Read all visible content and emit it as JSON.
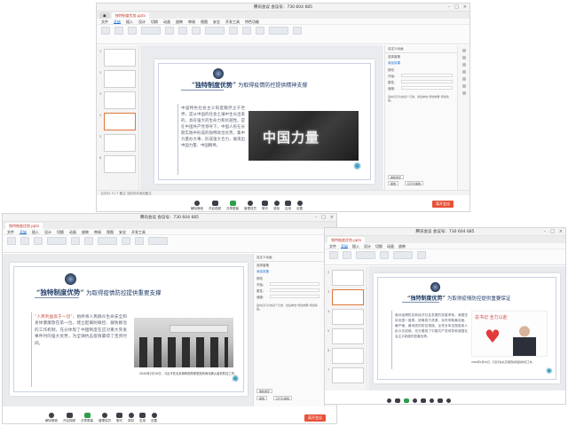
{
  "meeting": {
    "title": "腾讯会议 会议号：730 604 685",
    "end_label": "离开会议",
    "toolbar": [
      "解除静音",
      "开启视频",
      "共享屏幕",
      "管理成员",
      "聊天",
      "录制",
      "应用",
      "设置"
    ]
  },
  "editor": {
    "tab": "独特制度优势.pptx",
    "menus": [
      "文件",
      "开始",
      "插入",
      "设计",
      "切换",
      "动画",
      "放映",
      "审阅",
      "视图",
      "安全",
      "开发工具",
      "特色功能"
    ],
    "active_menu": "开始",
    "sidepanel": {
      "header": "自定义动画",
      "subheader": "选择窗格",
      "add_effect": "添加效果",
      "labels": [
        "修改",
        "开始：",
        "属性：",
        "速度："
      ],
      "hint": "选中幻灯片的某个元素，然后单击\"添加效果\"添加动画。",
      "buttons": [
        "重新排序",
        "播放",
        "幻灯片播放"
      ]
    },
    "status": "幻灯片 3 / 7    备注    当前页未添加备注"
  },
  "slides": [
    {
      "title_bold": "“独特制度优势”",
      "title_rest": "为取得疫情防控提供精神支撑",
      "body": "中国特色社会主义制度魏然立于世界，是从中国的社会土壤中生长出来的，具有强大的生命力和优越性。是在中国共产党领导下，中国人民在长期实践中形成的独特政治优势，集中力量办大事，形成强大合力，展现出中国力量、中国精神。",
      "photo_text": "中国力量"
    },
    {
      "title_bold": "“独特制度优势”",
      "title_rest": "为取得疫情防控提供重要支撑",
      "body_highlight": "“人民利益高于一切”，",
      "body": "始终将人民群众生命安全和身体健康放在第一位，建立起联防联控、群防群治的工作机制，充分体现了中国制度在应对重大突发事件时的强大优势，为全球抗击疫情赢得了宝贵时间。",
      "caption": "2020年2月10日，习近平在北京调研指导新型冠状病毒肺炎疫情防控工作。"
    },
    {
      "title_bold": "“独特制度优势”",
      "title_rest": "为取得疫情防控提供重要保证",
      "body": "面对疫情防控和经济社会发展的双重考验，我国坚持全国一盘棋，统筹各方资源，及时采取最全面、最严格、最彻底的防控措施，全党全军全国各族人民众志成城，充分展现了中国共产党领导和我国社会主义制度的显著优势。",
      "photo_text": "总书记 全力以赴",
      "caption": "2020年2月10日，习近平在北京调研指导疫情防控工作。"
    }
  ]
}
